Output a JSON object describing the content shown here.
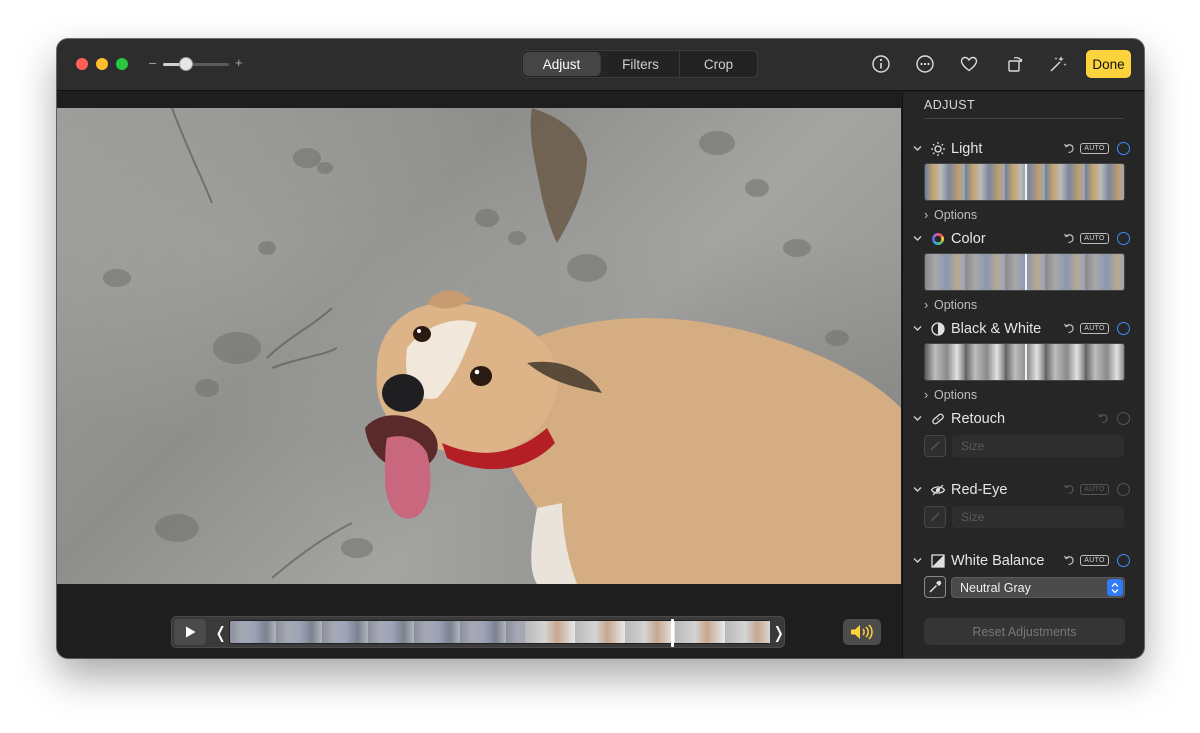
{
  "titlebar": {
    "zoom_minus": "–",
    "zoom_plus": "+",
    "zoom_level": 0.35,
    "tabs": [
      {
        "label": "Adjust",
        "active": true
      },
      {
        "label": "Filters",
        "active": false
      },
      {
        "label": "Crop",
        "active": false
      }
    ],
    "icons": [
      "info-icon",
      "more-icon",
      "favorite-icon",
      "rotate-icon",
      "auto-enhance-icon"
    ],
    "done_label": "Done",
    "done_color": "#fbd33c"
  },
  "player": {
    "trim_left": "❬",
    "trim_right": "❭",
    "playhead_position": 0.82,
    "volume_color": "#fbd33c"
  },
  "sidebar": {
    "title": "ADJUST",
    "accent_color": "#3b8cff",
    "sections": {
      "light": {
        "label": "Light",
        "auto": "AUTO",
        "options": "Options"
      },
      "color": {
        "label": "Color",
        "auto": "AUTO",
        "options": "Options"
      },
      "bw": {
        "label": "Black & White",
        "auto": "AUTO",
        "options": "Options"
      },
      "retouch": {
        "label": "Retouch",
        "size_placeholder": "Size"
      },
      "redeye": {
        "label": "Red-Eye",
        "auto": "AUTO",
        "size_placeholder": "Size"
      },
      "wb": {
        "label": "White Balance",
        "auto": "AUTO",
        "selected": "Neutral Gray"
      }
    },
    "reset_label": "Reset Adjustments"
  }
}
